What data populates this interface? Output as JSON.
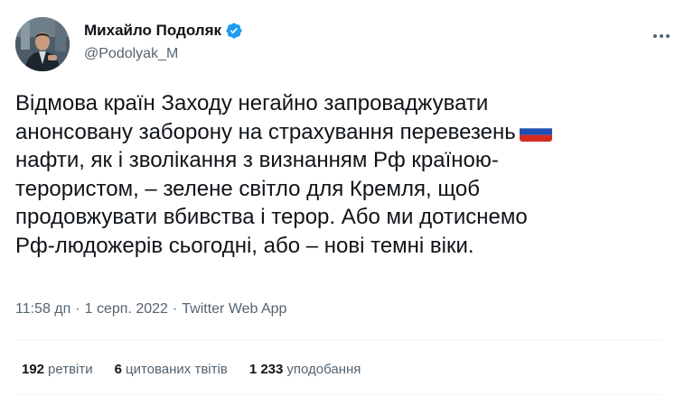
{
  "author": {
    "display_name": "Михайло Подоляк",
    "handle": "@Podolyak_M",
    "verified": true
  },
  "icons": {
    "avatar": "profile-photo",
    "verified": "verified-badge-icon",
    "more": "more-options-icon",
    "flag": "russia-flag-emoji"
  },
  "tweet": {
    "lines": [
      "Відмова країн Заходу негайно запроваджувати",
      "анонсовану заборону на страхування перевезень",
      "нафти, як і зволікання з визнанням Рф країною-",
      "терористом, – зелене світло для Кремля, щоб",
      "продовжувати вбивства і терор. Або ми дотиснемо",
      "Рф-людожерів сьогодні, або – нові темні віки."
    ]
  },
  "meta": {
    "time": "11:58 дп",
    "date": "1 серп. 2022",
    "source": "Twitter Web App",
    "separator": "·"
  },
  "stats": {
    "retweets_count": "192",
    "retweets_label": "ретвіти",
    "quotes_count": "6",
    "quotes_label": "цитованих твітів",
    "likes_count": "1 233",
    "likes_label": "уподобання"
  },
  "colors": {
    "text_primary": "#0f1419",
    "text_secondary": "#536471",
    "verified_blue": "#1d9bf0",
    "divider": "#eff3f4"
  }
}
